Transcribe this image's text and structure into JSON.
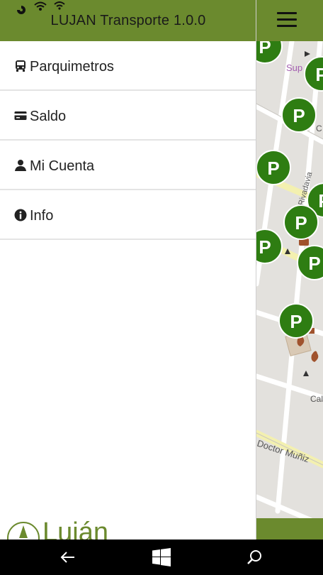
{
  "app": {
    "title": "LUJAN Transporte 1.0.0"
  },
  "menu": {
    "items": [
      {
        "label": "Parquimetros",
        "icon": "bus-icon"
      },
      {
        "label": "Saldo",
        "icon": "credit-card-icon"
      },
      {
        "label": "Mi Cuenta",
        "icon": "user-icon"
      },
      {
        "label": "Info",
        "icon": "info-icon"
      }
    ]
  },
  "logo": {
    "text": "Luján"
  },
  "map": {
    "labels": {
      "sup": "Sup",
      "rivadavia": "Rivadavia",
      "doctor_muniz": "Doctor Muñiz",
      "c1": "C",
      "c2": "Cal"
    },
    "marker_letter": "P"
  },
  "colors": {
    "brand_green": "#6b8a2e",
    "marker_green": "#2e7d12",
    "map_bg": "#e3e1dd",
    "road_yellow": "#f3f0b0"
  },
  "taskbar": {
    "icons": [
      "back-arrow-icon",
      "windows-start-icon",
      "search-icon"
    ]
  }
}
